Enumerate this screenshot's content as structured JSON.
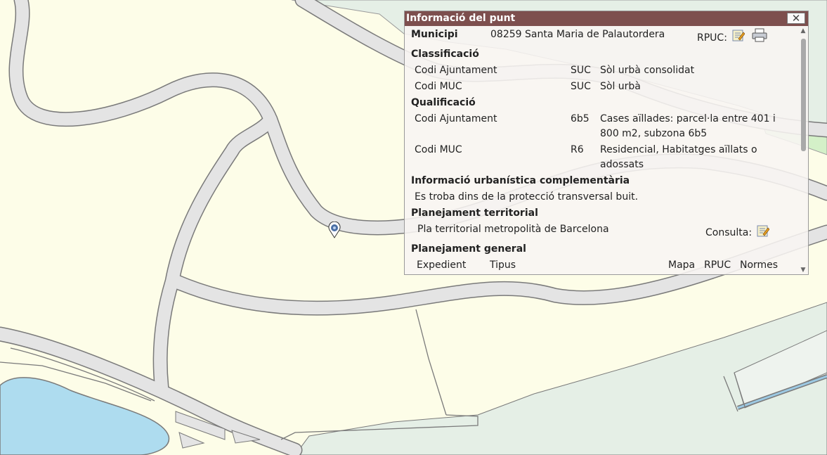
{
  "map": {
    "colors": {
      "background": "#fdfde8",
      "road_fill": "#e4e4e4",
      "road_edge": "#7a7a7a",
      "green_area": "#e5efe6",
      "water": "#aedcef",
      "rail": "#9cc9e3",
      "marker": "#4a6fa5"
    },
    "marker_icon": "location-pin-icon"
  },
  "popup": {
    "title": "Informació del punt",
    "close_icon": "close-icon",
    "municipi": {
      "label": "Municipi",
      "value": "08259 Santa Maria de Palautordera",
      "rpuc_label": "RPUC:",
      "edit_icon": "edit-document-icon",
      "print_icon": "printer-icon"
    },
    "classificacio": {
      "heading": "Classificació",
      "rows": [
        {
          "label": "Codi Ajuntament",
          "code": "SUC",
          "desc": [
            "Sòl urbà consolidat"
          ]
        },
        {
          "label": "Codi MUC",
          "code": "SUC",
          "desc": [
            "Sòl urbà"
          ]
        }
      ]
    },
    "qualificacio": {
      "heading": "Qualificació",
      "rows": [
        {
          "label": "Codi Ajuntament",
          "code": "6b5",
          "desc": [
            "Cases aïllades: parcel·la entre 401 i",
            "800 m2, subzona 6b5"
          ]
        },
        {
          "label": "Codi MUC",
          "code": "R6",
          "desc": [
            "Residencial, Habitatges aïllats o",
            "adossats"
          ]
        }
      ]
    },
    "info_complementaria": {
      "heading": "Informació urbanística complementària",
      "text": "Es troba dins de la protecció transversal buit."
    },
    "planejament_territorial": {
      "heading": "Planejament territorial",
      "text": "Pla territorial metropolità de Barcelona",
      "consulta_label": "Consulta:",
      "consulta_icon": "edit-document-icon"
    },
    "planejament_general": {
      "heading": "Planejament general",
      "columns": [
        "Expedient",
        "Tipus",
        "Mapa",
        "RPUC",
        "Normes"
      ]
    },
    "scrollbar": {
      "up_icon": "scroll-up-arrow-icon",
      "down_icon": "scroll-down-arrow-icon"
    }
  }
}
